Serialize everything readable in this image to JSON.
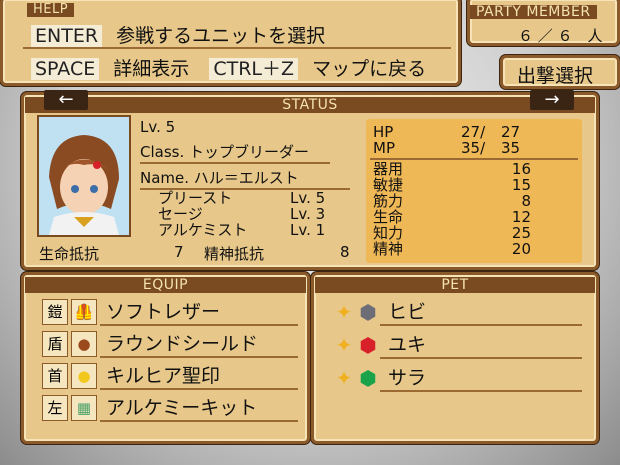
{
  "help": {
    "title": "HELP",
    "rows": [
      {
        "key": "ENTER",
        "desc": "参戦するユニットを選択"
      },
      {
        "key": "SPACE",
        "desc": "詳細表示",
        "key2": "CTRL＋Z",
        "desc2": "マップに戻る"
      }
    ]
  },
  "party": {
    "title": "PARTY MEMBER",
    "count": "６ ／ ６　人"
  },
  "sortie": {
    "label": "出撃選択"
  },
  "status": {
    "title": "STATUS",
    "prev": "←",
    "next": "→",
    "level": "Lv. 5",
    "class": "Class. トップブリーダー",
    "name": "Name. ハル＝エルスト",
    "jobs": [
      {
        "name": "プリースト",
        "lv": "Lv. 5"
      },
      {
        "name": "セージ",
        "lv": "Lv. 3"
      },
      {
        "name": "アルケミスト",
        "lv": "Lv. 1"
      }
    ],
    "resist": {
      "label1": "生命抵抗",
      "val1": "7",
      "label2": "精神抵抗",
      "val2": "8"
    },
    "hp": {
      "label": "HP",
      "cur": "27/",
      "max": "27"
    },
    "mp": {
      "label": "MP",
      "cur": "35/",
      "max": "35"
    },
    "stats": [
      {
        "label": "器用",
        "value": "16"
      },
      {
        "label": "敏捷",
        "value": "15"
      },
      {
        "label": "筋力",
        "value": "8"
      },
      {
        "label": "生命",
        "value": "12"
      },
      {
        "label": "知力",
        "value": "25"
      },
      {
        "label": "精神",
        "value": "20"
      }
    ]
  },
  "equip": {
    "title": "EQUIP",
    "items": [
      {
        "slot": "鎧",
        "icon": "leather-armor-icon",
        "name": "ソフトレザー"
      },
      {
        "slot": "盾",
        "icon": "round-shield-icon",
        "name": "ラウンドシールド"
      },
      {
        "slot": "首",
        "icon": "seal-icon",
        "name": "キルヒア聖印"
      },
      {
        "slot": "左",
        "icon": "kit-icon",
        "name": "アルケミーキット"
      }
    ]
  },
  "pet": {
    "title": "PET",
    "items": [
      {
        "gem": "gray-gem-icon",
        "color": "#6d6d78",
        "name": "ヒビ"
      },
      {
        "gem": "red-gem-icon",
        "color": "#d8202a",
        "name": "ユキ"
      },
      {
        "gem": "green-gem-icon",
        "color": "#1aa34a",
        "name": "サラ"
      }
    ]
  }
}
